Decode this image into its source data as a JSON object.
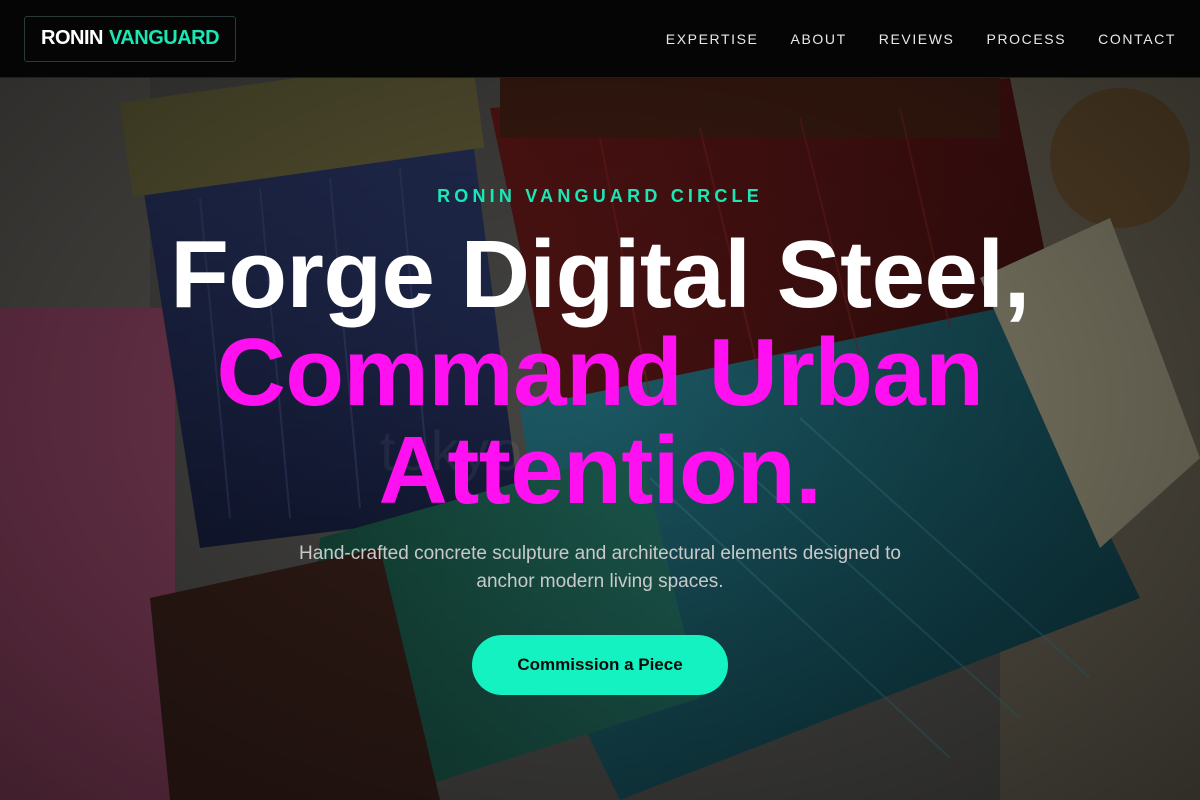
{
  "brand": {
    "word1": "RONIN",
    "word2": "VANGUARD"
  },
  "nav": {
    "items": [
      "EXPERTISE",
      "ABOUT",
      "REVIEWS",
      "PROCESS",
      "CONTACT"
    ]
  },
  "hero": {
    "eyebrow": "RONIN VANGUARD CIRCLE",
    "headline_line1": "Forge Digital Steel,",
    "headline_line2": "Command Urban Attention.",
    "subtext": "Hand-crafted concrete sculpture and architectural elements designed to anchor modern living spaces.",
    "cta_label": "Commission a Piece",
    "background_image": "paint-brushes-photo",
    "watermark": "tokyo"
  },
  "colors": {
    "accent_teal": "#19e8b5",
    "accent_magenta": "#ff10f0",
    "cta_bg": "#13f2c0",
    "header_bg": "#050505"
  }
}
